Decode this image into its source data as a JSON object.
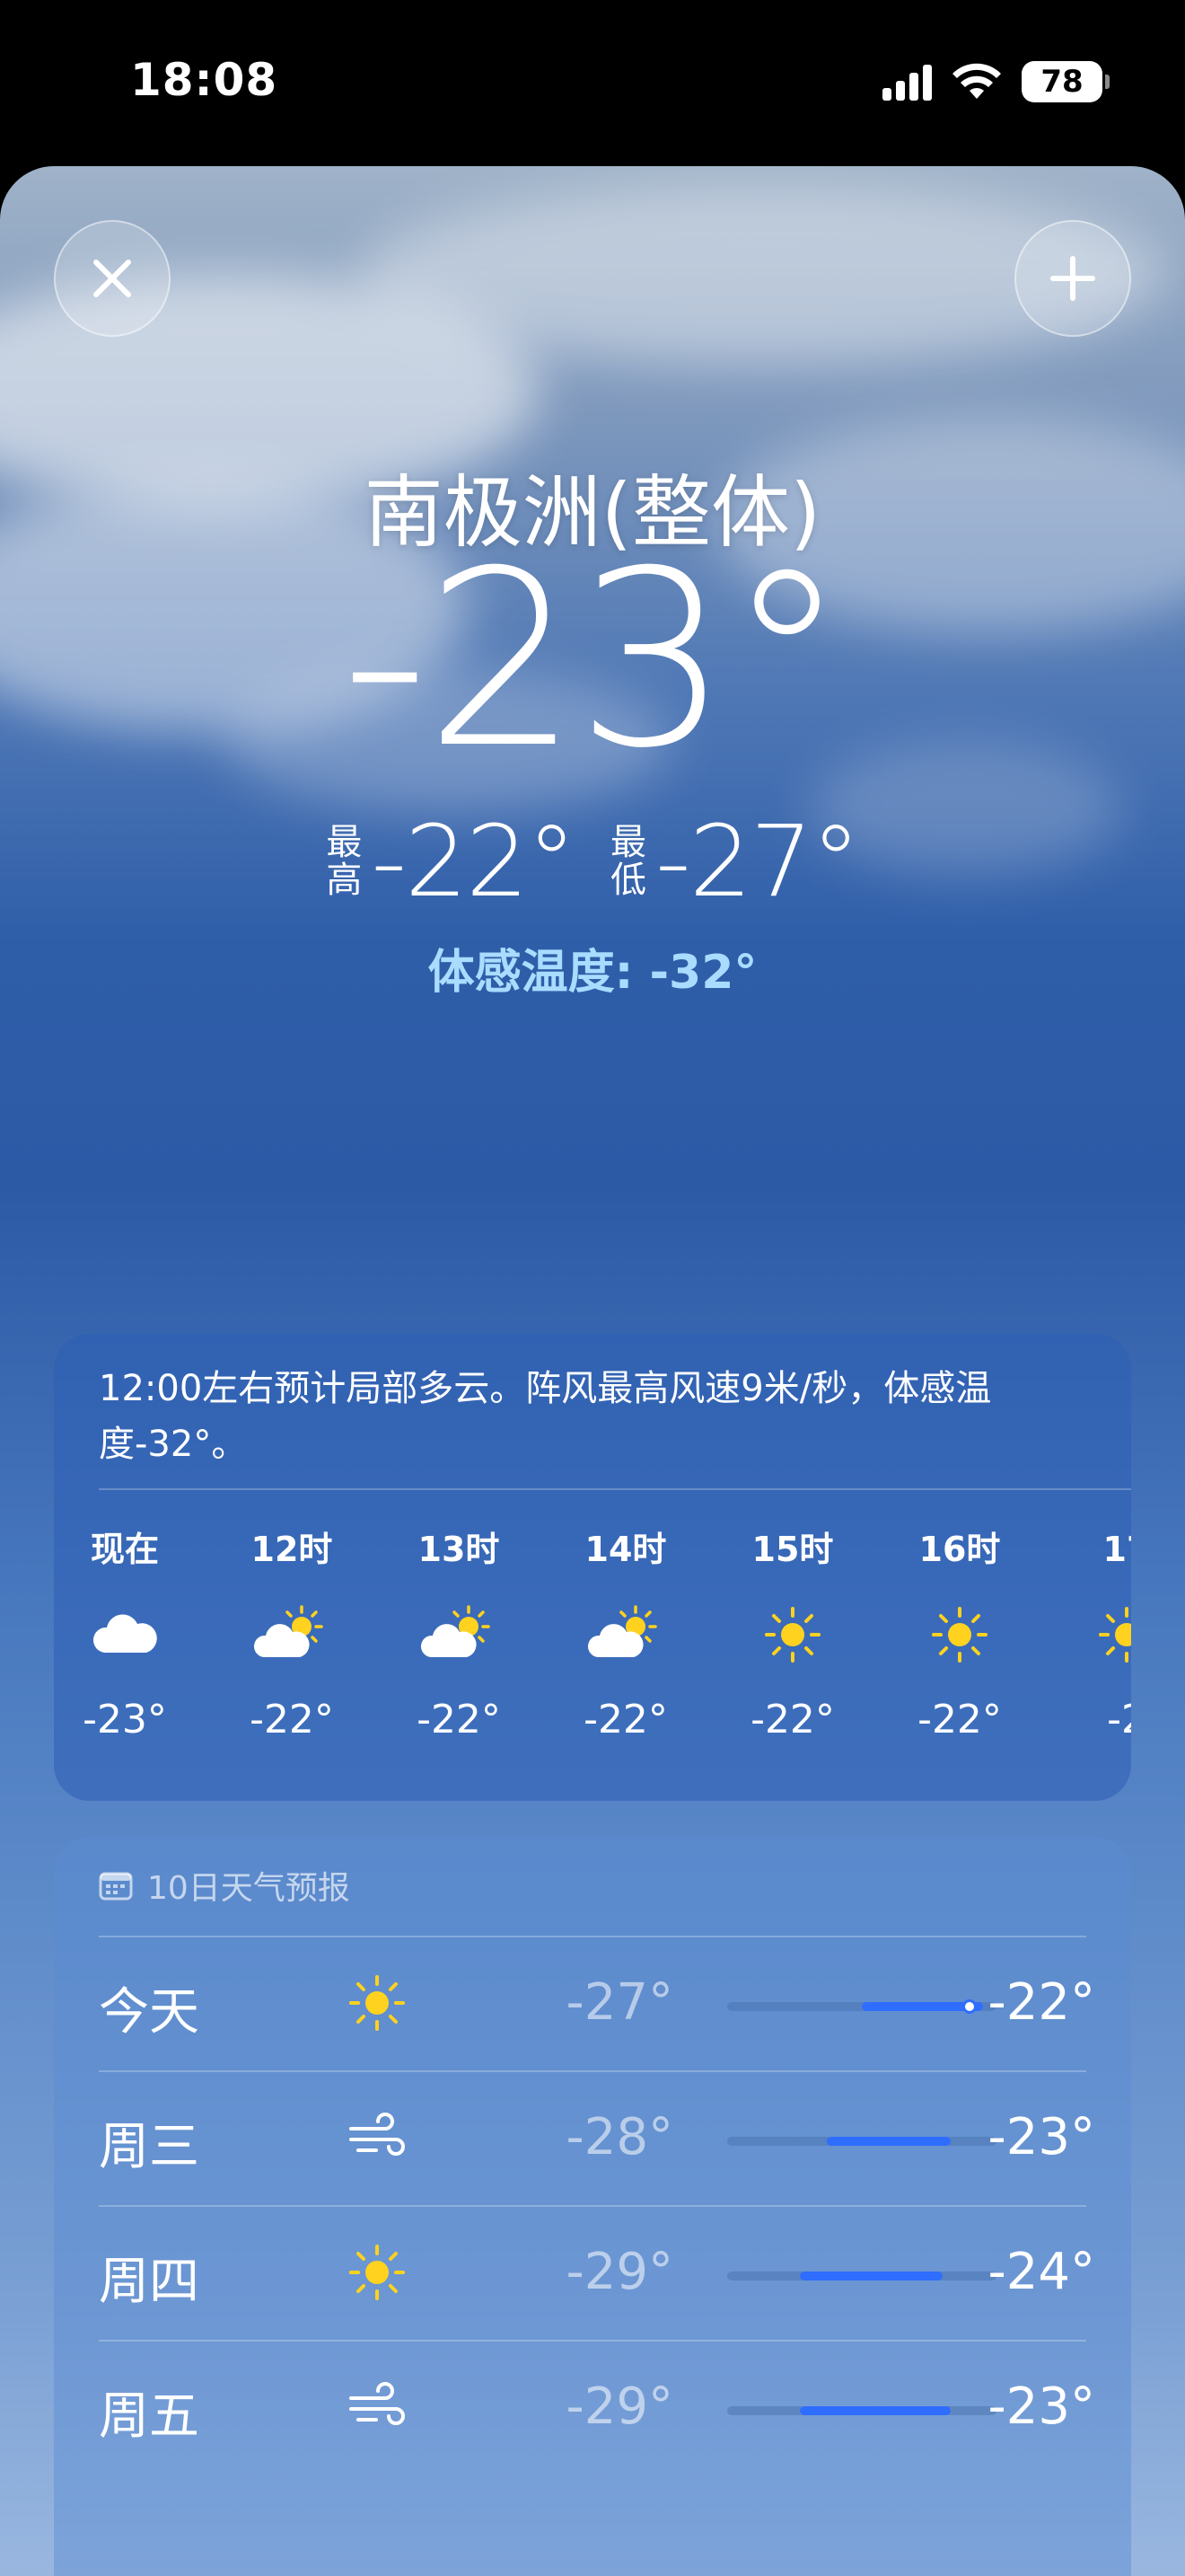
{
  "status_bar": {
    "time": "18:08",
    "battery": "78"
  },
  "header": {
    "location": "南极洲(整体)",
    "temperature": "-23°",
    "high_label_top": "最",
    "high_label_bottom": "高",
    "high": "-22°",
    "low_label_top": "最",
    "low_label_bottom": "低",
    "low": "-27°",
    "feels_like": "体感温度: -32°"
  },
  "hourly": {
    "summary": "12:00左右预计局部多云。阵风最高风速9米/秒，体感温度-32°。",
    "items": [
      {
        "hour": "现在",
        "icon": "cloud-icon",
        "temp": "-23°"
      },
      {
        "hour": "12时",
        "icon": "partly-sunny-icon",
        "temp": "-22°"
      },
      {
        "hour": "13时",
        "icon": "partly-sunny-icon",
        "temp": "-22°"
      },
      {
        "hour": "14时",
        "icon": "partly-sunny-icon",
        "temp": "-22°"
      },
      {
        "hour": "15时",
        "icon": "sun-icon",
        "temp": "-22°"
      },
      {
        "hour": "16时",
        "icon": "sun-icon",
        "temp": "-22°"
      },
      {
        "hour": "17",
        "icon": "sun-icon",
        "temp": "-2"
      }
    ]
  },
  "daily": {
    "title": "10日天气预报",
    "rows": [
      {
        "day": "今天",
        "icon": "sun-icon",
        "low": "-27°",
        "high": "-22°",
        "range_start": 0.5,
        "range_end": 0.95,
        "current": 0.9
      },
      {
        "day": "周三",
        "icon": "wind-icon",
        "low": "-28°",
        "high": "-23°",
        "range_start": 0.37,
        "range_end": 0.83
      },
      {
        "day": "周四",
        "icon": "sun-icon",
        "low": "-29°",
        "high": "-24°",
        "range_start": 0.27,
        "range_end": 0.8
      },
      {
        "day": "周五",
        "icon": "wind-icon",
        "low": "-29°",
        "high": "-23°",
        "range_start": 0.27,
        "range_end": 0.83
      }
    ]
  },
  "colors": {
    "accent_blue": "#2f6dff",
    "feels_like": "#a9dcff"
  }
}
